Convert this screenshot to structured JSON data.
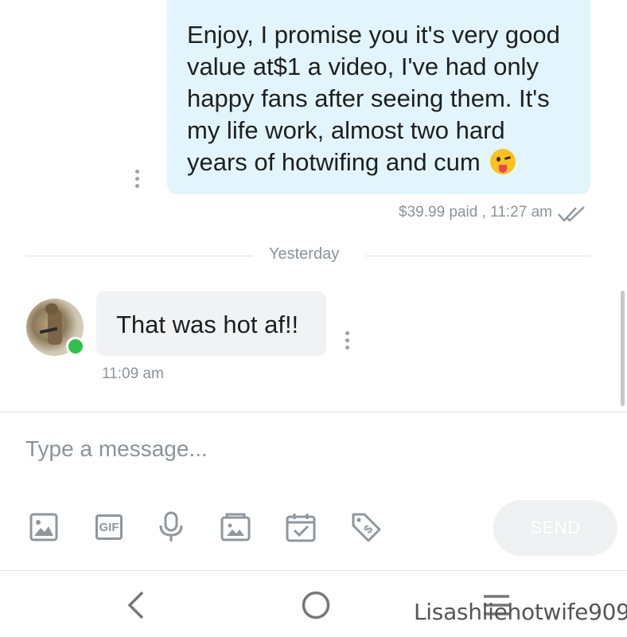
{
  "messages": {
    "outgoing": {
      "text": "Enjoy, I promise you it's very good value at$1 a video, I've had only happy fans after seeing them. It's my life work, almost two hard years of hotwifing and cum",
      "emoji": "winking-face-with-tongue",
      "meta": "$39.99 paid , 11:27 am",
      "status_icon": "double-check-icon"
    },
    "date_separator": "Yesterday",
    "incoming": {
      "text": "That was hot af!!",
      "time": "11:09 am",
      "sender_online": true
    }
  },
  "composer": {
    "placeholder": "Type a message...",
    "tools": [
      "image-icon",
      "gif-icon",
      "microphone-icon",
      "media-vault-icon",
      "schedule-calendar-icon",
      "price-tag-icon"
    ],
    "gif_label": "GIF",
    "send_label": "SEND"
  },
  "system_nav": [
    "back",
    "home",
    "menu"
  ],
  "watermark": "Lisashliehotwife909",
  "colors": {
    "outgoing_bubble": "#e2f5fc",
    "incoming_bubble": "#f0f2f4",
    "online": "#2fbf4b",
    "icon_gray": "#8e979e",
    "meta_text": "#8a949c"
  }
}
